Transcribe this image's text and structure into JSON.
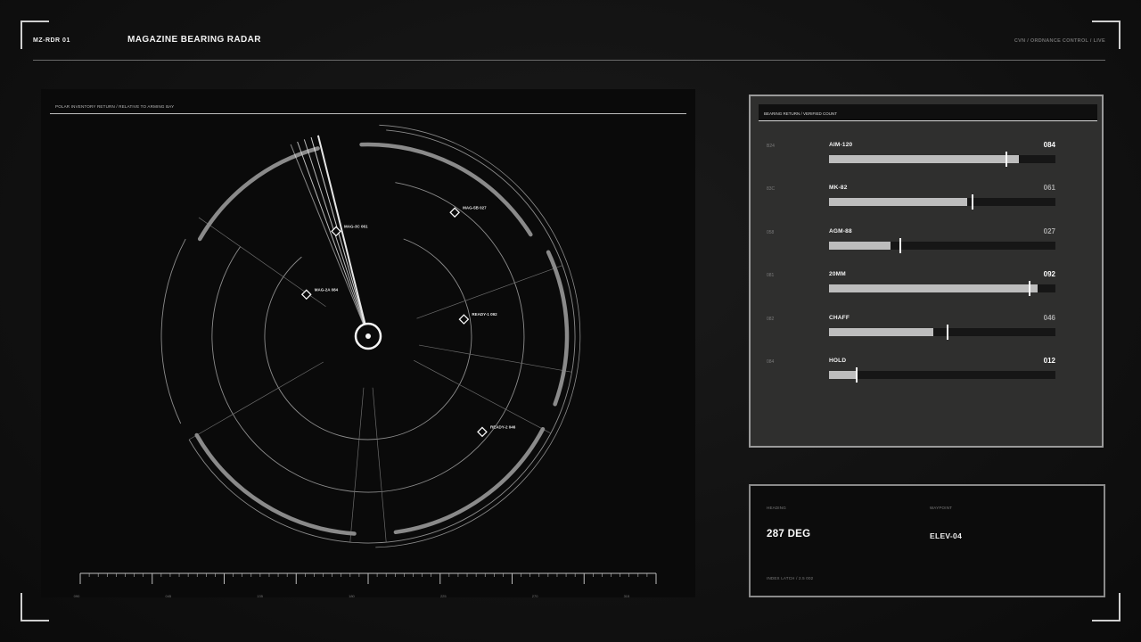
{
  "header": {
    "code": "MZ-RDR 01",
    "title": "MAGAZINE BEARING RADAR",
    "context": "CVN / ORDNANCE CONTROL / LIVE"
  },
  "radar": {
    "subtitle": "POLAR INVENTORY RETURN / RELATIVE TO ARMING BAY",
    "contacts": [
      {
        "id": "c-mag3c",
        "label": "MAG-3C 061",
        "bearing_deg": 343,
        "range": 0.53
      },
      {
        "id": "c-mag5b",
        "label": "MAG-5B 027",
        "bearing_deg": 35,
        "range": 0.73
      },
      {
        "id": "c-mag2a",
        "label": "MAG-2A 084",
        "bearing_deg": 304,
        "range": 0.36
      },
      {
        "id": "c-ready1",
        "label": "READY-1 092",
        "bearing_deg": 80,
        "range": 0.47
      },
      {
        "id": "c-ready2",
        "label": "READY-2 046",
        "bearing_deg": 130,
        "range": 0.72
      }
    ],
    "sweep_bearing_deg": 344,
    "scale_labels": [
      "090",
      "045",
      "135",
      "180",
      "225",
      "270",
      "315",
      "360"
    ]
  },
  "inventory": {
    "title": "BEARING RETURN / VERIFIED COUNT",
    "rows": [
      {
        "code": "B24",
        "name": "AIM-120",
        "value": "084",
        "fill": 0.84,
        "marker": 0.78,
        "dim": false
      },
      {
        "code": "83C",
        "name": "MK-82",
        "value": "061",
        "fill": 0.61,
        "marker": 0.63,
        "dim": true
      },
      {
        "code": "058",
        "name": "AGM-88",
        "value": "027",
        "fill": 0.27,
        "marker": 0.31,
        "dim": true
      },
      {
        "code": "081",
        "name": "20MM",
        "value": "092",
        "fill": 0.92,
        "marker": 0.88,
        "dim": false
      },
      {
        "code": "082",
        "name": "CHAFF",
        "value": "046",
        "fill": 0.46,
        "marker": 0.52,
        "dim": true
      },
      {
        "code": "084",
        "name": "HOLD",
        "value": "012",
        "fill": 0.12,
        "marker": 0.12,
        "dim": false
      }
    ]
  },
  "nav": {
    "heading_label": "HEADING",
    "heading_value": "287 DEG",
    "waypoint_label": "WAYPOINT",
    "waypoint_value": "ELEV-04",
    "latch": "INDEX LATCH / 2.5 002"
  },
  "colors": {
    "bg": "#121212",
    "panel": "#2f2f2e",
    "accent": "#f2f2f2",
    "fill": "#bdbdbd"
  }
}
